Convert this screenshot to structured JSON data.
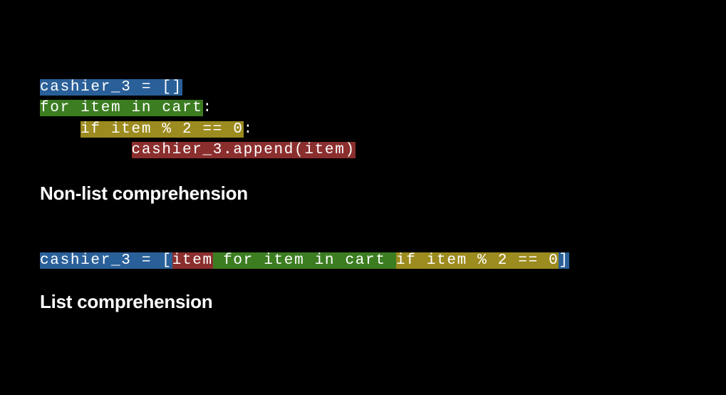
{
  "block1": {
    "line1": "cashier_3 = []",
    "line2_hl": "for item in cart",
    "line2_colon": ":",
    "line3_indent": "    ",
    "line3_hl": "if item % 2 == 0",
    "line3_colon": ":",
    "line4_indent": "         ",
    "line4_hl": "cashier_3.append(item)"
  },
  "label1": "Non-list comprehension",
  "block2": {
    "prefix": "cashier_3 = ",
    "bracket_open": "[",
    "red": "item",
    "green": " for item in cart ",
    "olive": "if item % 2 == 0",
    "bracket_close": "]"
  },
  "label2": "List comprehension",
  "colors": {
    "blue": "#2a6099",
    "green": "#3c7d22",
    "olive": "#9c8b1e",
    "red": "#8b2e2e"
  }
}
